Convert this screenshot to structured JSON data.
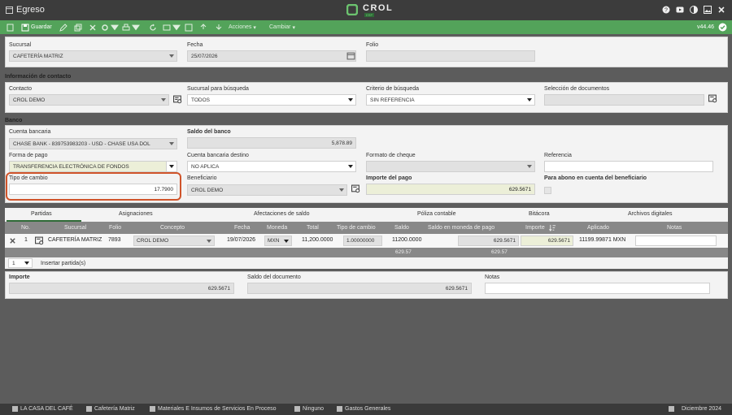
{
  "window": {
    "title": "Egreso",
    "logo_text": "CROL",
    "logo_sub": "ERP"
  },
  "toolbar": {
    "save_label": "Guardar",
    "acciones_label": "Acciones",
    "cambiar_label": "Cambiar",
    "version": "v44.46"
  },
  "header": {
    "sucursal_label": "Sucursal",
    "sucursal_value": "CAFETERÍA MATRIZ",
    "fecha_label": "Fecha",
    "fecha_value": "25/07/2026",
    "folio_label": "Folio",
    "folio_value": ""
  },
  "contact": {
    "section_title": "Información de contacto",
    "contacto_label": "Contacto",
    "contacto_value": "CROL DEMO",
    "sucursal_busqueda_label": "Sucursal para búsqueda",
    "sucursal_busqueda_value": "TODOS",
    "criterio_label": "Criterio de búsqueda",
    "criterio_value": "SIN REFERENCIA",
    "seleccion_label": "Selección de documentos",
    "seleccion_value": ""
  },
  "bank": {
    "section_title": "Banco",
    "cuenta_label": "Cuenta bancaria",
    "cuenta_value": "CHASE BANK - 839753983203 - USD - CHASE USA DOL",
    "saldo_label": "Saldo del banco",
    "saldo_value": "5,878.89",
    "forma_label": "Forma de pago",
    "forma_value": "TRANSFERENCIA ELECTRÓNICA DE FONDOS",
    "cuenta_destino_label": "Cuenta bancaria destino",
    "cuenta_destino_value": "NO APLICA",
    "formato_label": "Formato de cheque",
    "formato_value": "",
    "referencia_label": "Referencia",
    "referencia_value": "",
    "tipo_cambio_label": "Tipo de cambio",
    "tipo_cambio_value": "17.7900",
    "beneficiario_label": "Beneficiario",
    "beneficiario_value": "CROL DEMO",
    "importe_label": "Importe del pago",
    "importe_value": "629.5671",
    "abono_label": "Para abono en cuenta del beneficiario"
  },
  "tabs": [
    "Partidas",
    "Asignaciones",
    "Afectaciones de saldo",
    "Póliza contable",
    "Bitácora",
    "Archivos digitales"
  ],
  "table": {
    "columns": [
      "No.",
      "Sucursal",
      "Folio",
      "Concepto",
      "Fecha",
      "Moneda",
      "Total",
      "Tipo de cambio",
      "Saldo",
      "Saldo en moneda de pago",
      "Importe",
      "Aplicado",
      "Notas"
    ],
    "row": {
      "no": "1",
      "sucursal": "CAFETERÍA MATRIZ",
      "folio": "7893",
      "concepto": "CROL DEMO",
      "fecha": "19/07/2026",
      "moneda": "MXN",
      "total": "11,200.0000",
      "tipo_cambio": "1.00000000",
      "saldo": "11200.0000",
      "saldo_moneda": "629.5671",
      "importe": "629.5671",
      "aplicado": "11199.99871 MXN",
      "notas": ""
    },
    "totals": {
      "saldo": "629.57",
      "saldo_moneda": "629.57"
    }
  },
  "pager": {
    "count": "1",
    "insert_label": "Insertar partida(s)"
  },
  "summary": {
    "importe_label": "Importe",
    "importe_value": "629.5671",
    "saldo_label": "Saldo del documento",
    "saldo_value": "629.5671",
    "notas_label": "Notas",
    "notas_value": ""
  },
  "status": {
    "company": "LA CASA DEL CAFÉ",
    "branch": "Cafetería Matriz",
    "category": "Materiales E Insumos de Servicios En Proceso",
    "none": "Ninguno",
    "expenses": "Gastos Generales",
    "period": "Diciembre 2024"
  }
}
